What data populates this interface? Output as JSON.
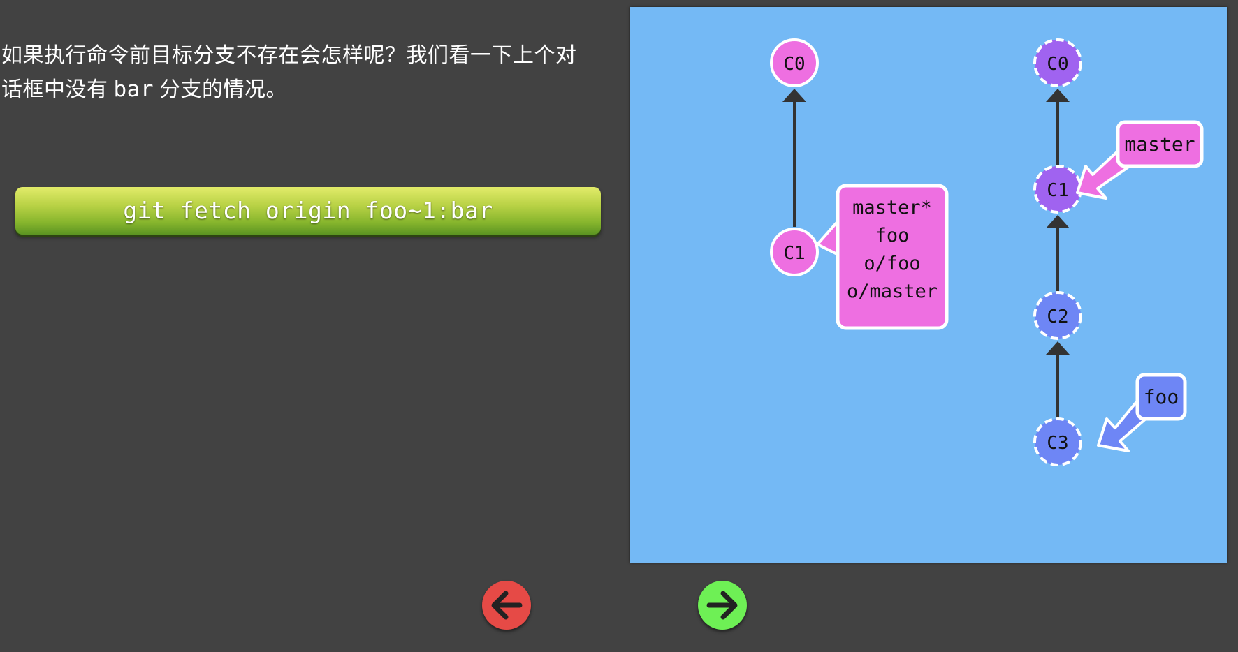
{
  "explanation": {
    "line1": "如果执行命令前目标分支不存在会怎样呢？我们看一下上个对",
    "line2_before": "话框中没有",
    "line2_code": "bar",
    "line2_after": "分支的情况。"
  },
  "command": {
    "label": "git fetch origin foo~1:bar"
  },
  "visualization": {
    "local_repo": {
      "commits": [
        {
          "id": "C0"
        },
        {
          "id": "C1"
        }
      ],
      "branch_labels": [
        "master*",
        "foo",
        "o/foo",
        "o/master"
      ]
    },
    "remote_repo": {
      "commits": [
        {
          "id": "C0"
        },
        {
          "id": "C1"
        },
        {
          "id": "C2"
        },
        {
          "id": "C3"
        }
      ],
      "branches": [
        {
          "name": "master",
          "color": "#ee6fe1"
        },
        {
          "name": "foo",
          "color": "#6e86f5"
        }
      ]
    },
    "colors": {
      "background": "#74b9f5",
      "local_commit": "#ee6fe1",
      "remote_commit_purple": "#a063f0",
      "remote_commit_blue": "#6e86f5",
      "branch_pink": "#ee6fe1",
      "branch_blue": "#6e86f5",
      "edge": "#333333"
    }
  },
  "navigation": {
    "prev_icon": "arrow-left-icon",
    "next_icon": "arrow-right-icon",
    "prev_color": "#e64a46",
    "next_color": "#6ef055"
  }
}
